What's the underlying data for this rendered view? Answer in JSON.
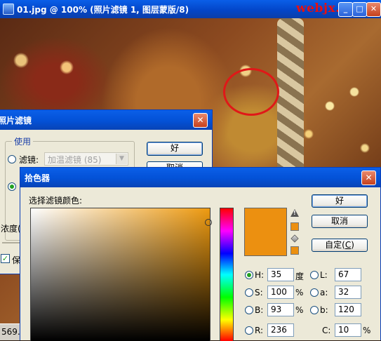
{
  "document": {
    "title": "01.jpg @ 100% (照片滤镜 1, 图层蒙版/8)",
    "watermark": "webjx.com",
    "controls": {
      "minimize": "_",
      "maximize": "□",
      "close": "✕"
    },
    "status_zoom": "569."
  },
  "photo_filter_dialog": {
    "title": "照片滤镜",
    "use_group_label": "使用",
    "filter_radio_label": "滤镜:",
    "filter_value": "加温滤镜 (85)",
    "density_label": "浓度(",
    "preserve_label": "保",
    "ok_label": "好",
    "cancel_label": "取消",
    "close": "✕"
  },
  "color_picker": {
    "title": "拾色器",
    "prompt": "选择滤镜颜色:",
    "ok_label": "好",
    "cancel_label": "取消",
    "custom_label": "自定",
    "custom_key": "C",
    "close": "✕",
    "selected_color": "#EC9010",
    "hsb": {
      "h": {
        "label": "H:",
        "value": "35",
        "unit": "度",
        "selected": true
      },
      "s": {
        "label": "S:",
        "value": "100",
        "unit": "%"
      },
      "b": {
        "label": "B:",
        "value": "93",
        "unit": "%"
      }
    },
    "rgb": {
      "r": {
        "label": "R:",
        "value": "236"
      }
    },
    "lab": {
      "l": {
        "label": "L:",
        "value": "67"
      },
      "a": {
        "label": "a:",
        "value": "32"
      },
      "b": {
        "label": "b:",
        "value": "120"
      }
    },
    "cmyk": {
      "c": {
        "label": "C:",
        "value": "10",
        "unit": "%"
      }
    }
  }
}
